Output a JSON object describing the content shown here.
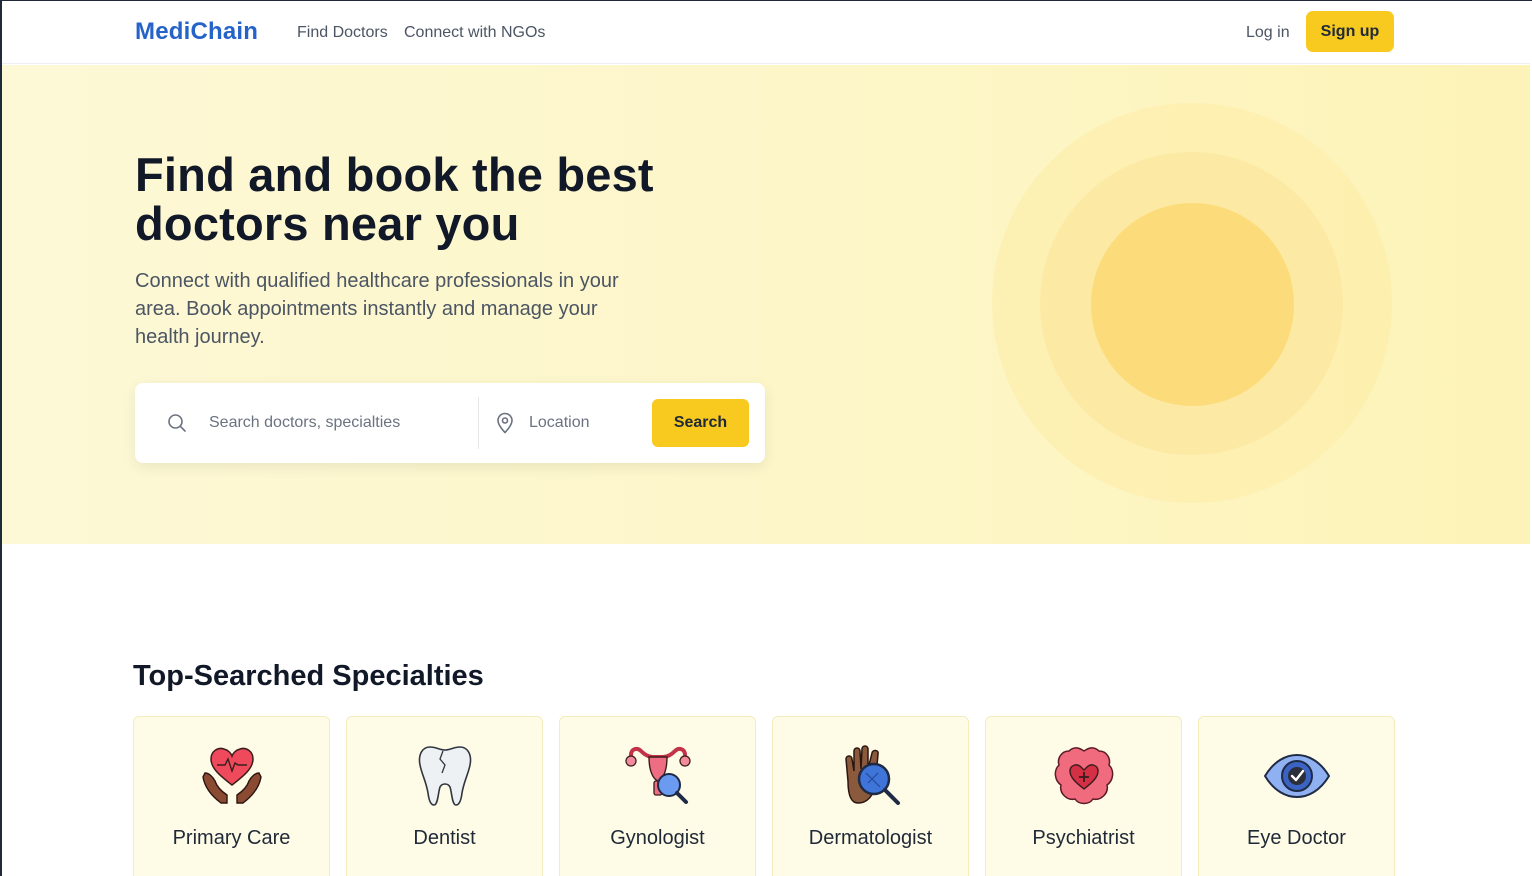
{
  "brand": {
    "name": "MediChain",
    "color": "#2563c9",
    "accent": "#f8c91e"
  },
  "nav": {
    "links": [
      {
        "label": "Find Doctors"
      },
      {
        "label": "Connect with NGOs"
      }
    ],
    "login_label": "Log in",
    "signup_label": "Sign up"
  },
  "hero": {
    "title": "Find and book the best doctors near you",
    "subtitle": "Connect with qualified healthcare professionals in your area. Book appointments instantly and manage your health journey.",
    "search": {
      "query_placeholder": "Search doctors, specialties",
      "query_value": "",
      "location_placeholder": "Location",
      "location_value": "",
      "button_label": "Search",
      "search_icon": "search-icon",
      "location_icon": "map-pin-icon"
    }
  },
  "specialties": {
    "title": "Top-Searched Specialties",
    "items": [
      {
        "label": "Primary Care",
        "icon": "heart-hands-icon"
      },
      {
        "label": "Dentist",
        "icon": "tooth-icon"
      },
      {
        "label": "Gynologist",
        "icon": "uterus-magnifier-icon"
      },
      {
        "label": "Dermatologist",
        "icon": "hand-magnifier-icon"
      },
      {
        "label": "Psychiatrist",
        "icon": "brain-heart-icon"
      },
      {
        "label": "Eye Doctor",
        "icon": "eye-check-icon"
      }
    ]
  }
}
